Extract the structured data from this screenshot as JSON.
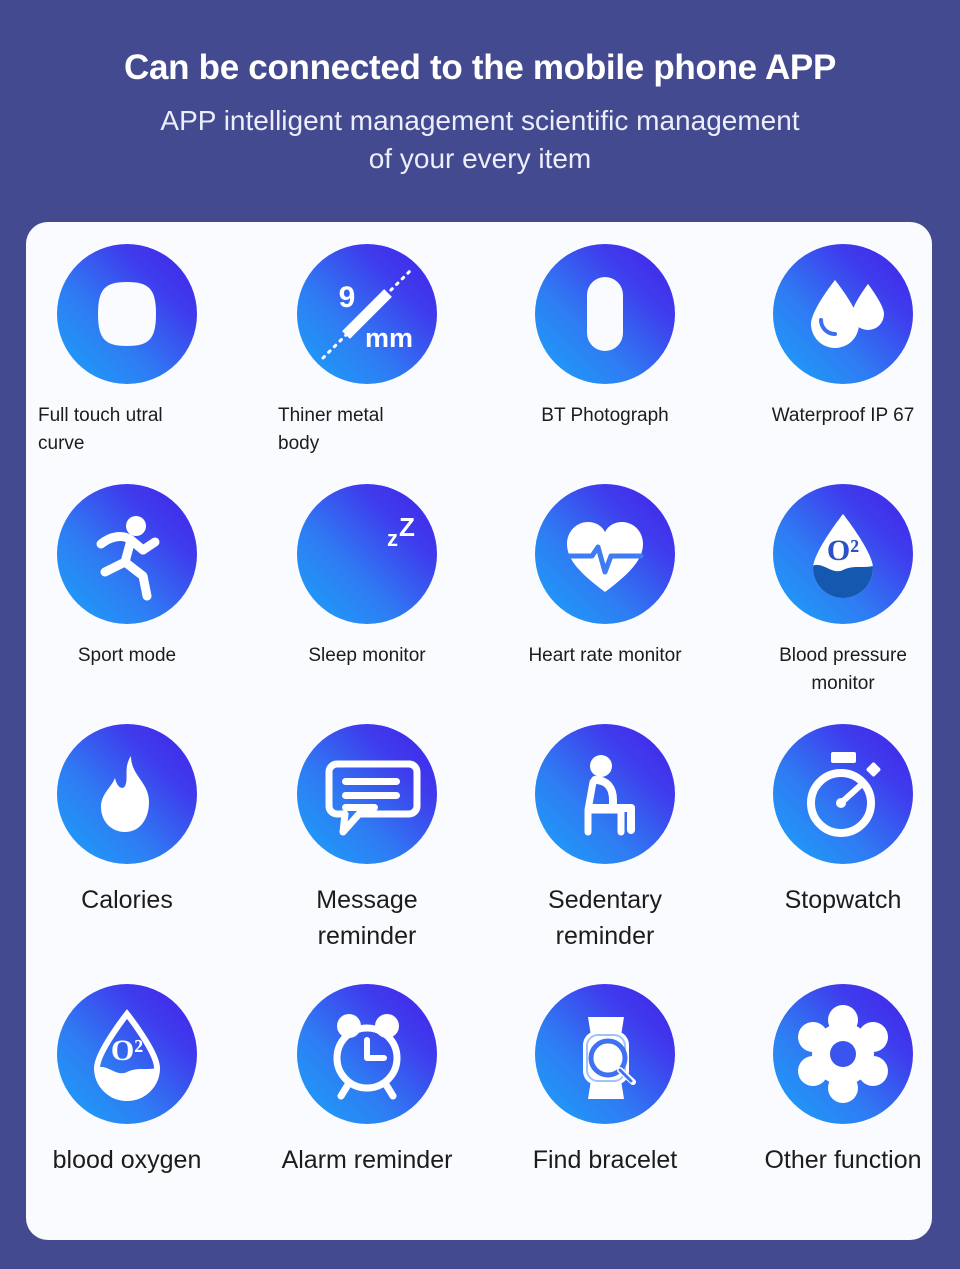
{
  "header": {
    "title": "Can be connected to the mobile phone APP",
    "subtitle": "APP intelligent management scientific management of your every item"
  },
  "theme": {
    "background": "#434a90",
    "card_background": "#fafbfe",
    "icon_gradient_start": "#1aa4f8",
    "icon_gradient_end": "#4122e8",
    "label_color": "#1c1c1c",
    "title_color": "#ffffff"
  },
  "features": [
    {
      "id": "full-touch-utral-curve",
      "label": "Full touch utral\ncurve",
      "icon": "squircle-screen-icon"
    },
    {
      "id": "thiner-metal-body",
      "label": "Thiner metal\nbody",
      "icon": "thickness-9mm-icon",
      "value": "9",
      "unit": "mm"
    },
    {
      "id": "bt-photograph",
      "label": "BT Photograph",
      "icon": "capsule-shutter-icon"
    },
    {
      "id": "waterproof-ip67",
      "label": "Waterproof IP 67",
      "icon": "water-drops-icon"
    },
    {
      "id": "sport-mode",
      "label": "Sport mode",
      "icon": "running-person-icon"
    },
    {
      "id": "sleep-monitor",
      "label": "Sleep monitor",
      "icon": "moon-zzz-icon",
      "badge": "zZ"
    },
    {
      "id": "heart-rate-monitor",
      "label": "Heart rate monitor",
      "icon": "heart-pulse-icon"
    },
    {
      "id": "blood-pressure-monitor",
      "label": "Blood pressure\nmonitor",
      "icon": "o2-droplet-filled-icon",
      "badge": "O²"
    },
    {
      "id": "calories",
      "label": "Calories",
      "icon": "flame-icon"
    },
    {
      "id": "message-reminder",
      "label": "Message\nreminder",
      "icon": "speech-bubble-icon"
    },
    {
      "id": "sedentary-reminder",
      "label": "Sedentary\nreminder",
      "icon": "sitting-person-icon"
    },
    {
      "id": "stopwatch",
      "label": "Stopwatch",
      "icon": "stopwatch-icon"
    },
    {
      "id": "blood-oxygen",
      "label": "blood oxygen",
      "icon": "o2-droplet-outline-icon",
      "badge": "O²"
    },
    {
      "id": "alarm-reminder",
      "label": "Alarm reminder",
      "icon": "alarm-clock-icon"
    },
    {
      "id": "find-bracelet",
      "label": "Find bracelet",
      "icon": "watch-search-icon"
    },
    {
      "id": "other-function",
      "label": "Other function",
      "icon": "gear-icon"
    }
  ]
}
